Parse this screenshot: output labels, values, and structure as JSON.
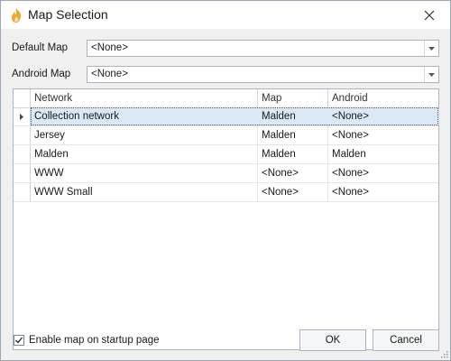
{
  "window": {
    "title": "Map Selection",
    "app_icon": "flame-icon",
    "close_icon": "close-icon"
  },
  "form": {
    "default_map": {
      "label": "Default Map",
      "value": "<None>"
    },
    "android_map": {
      "label": "Android Map",
      "value": "<None>"
    }
  },
  "grid": {
    "columns": [
      "Network",
      "Map",
      "Android"
    ],
    "rows": [
      {
        "network": "Collection network",
        "map": "Malden",
        "android": "<None>",
        "selected": true
      },
      {
        "network": "Jersey",
        "map": "Malden",
        "android": "<None>"
      },
      {
        "network": "Malden",
        "map": "Malden",
        "android": "Malden"
      },
      {
        "network": "WWW",
        "map": "<None>",
        "android": "<None>"
      },
      {
        "network": "WWW Small",
        "map": "<None>",
        "android": "<None>"
      }
    ]
  },
  "footer": {
    "checkbox_label": "Enable map on startup page",
    "checkbox_checked": true,
    "ok_label": "OK",
    "cancel_label": "Cancel"
  },
  "colors": {
    "accent": "#f0a830",
    "selection": "#dbe8f5"
  }
}
